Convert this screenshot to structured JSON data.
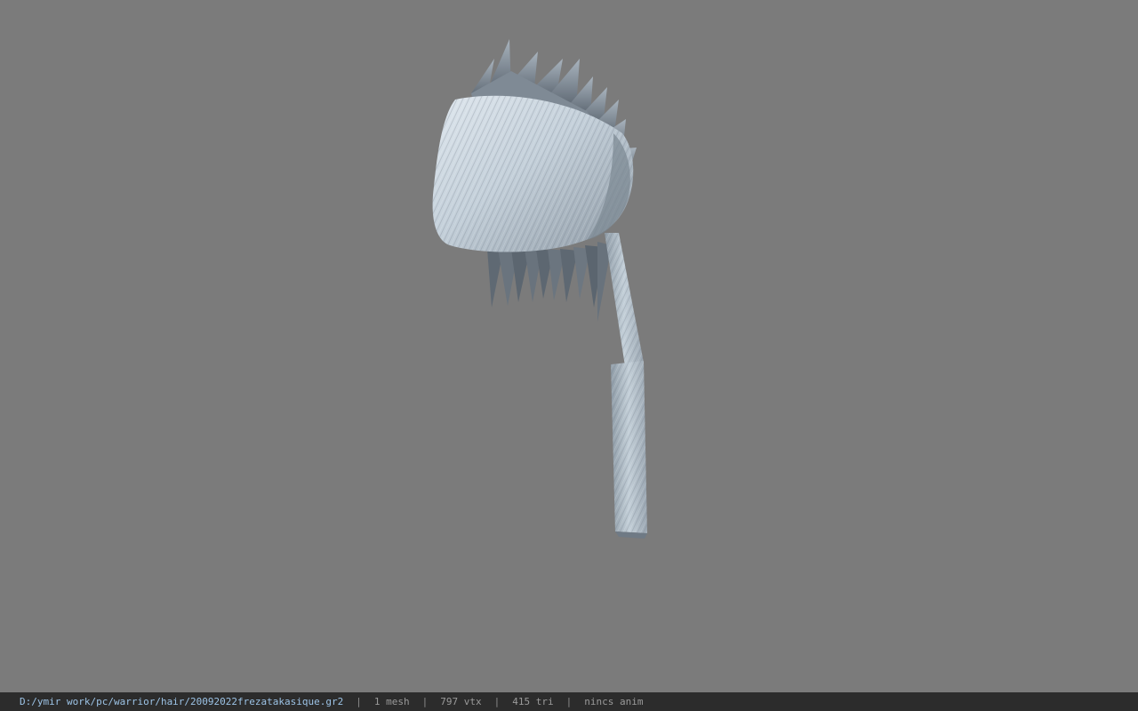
{
  "viewport": {
    "background_color": "#7b7b7b",
    "model": {
      "name": "hair-mesh",
      "material_color": "#b9c6d0",
      "shadow_color": "#56606a"
    }
  },
  "status_bar": {
    "background_color": "#2c2c2c",
    "file_path": "D:/ymir work/pc/warrior/hair/20092022frezatakasique.gr2",
    "separator": "|",
    "mesh_count": "1 mesh",
    "vertex_count": "797 vtx",
    "triangle_count": "415 tri",
    "animation_status": "nincs anim"
  }
}
